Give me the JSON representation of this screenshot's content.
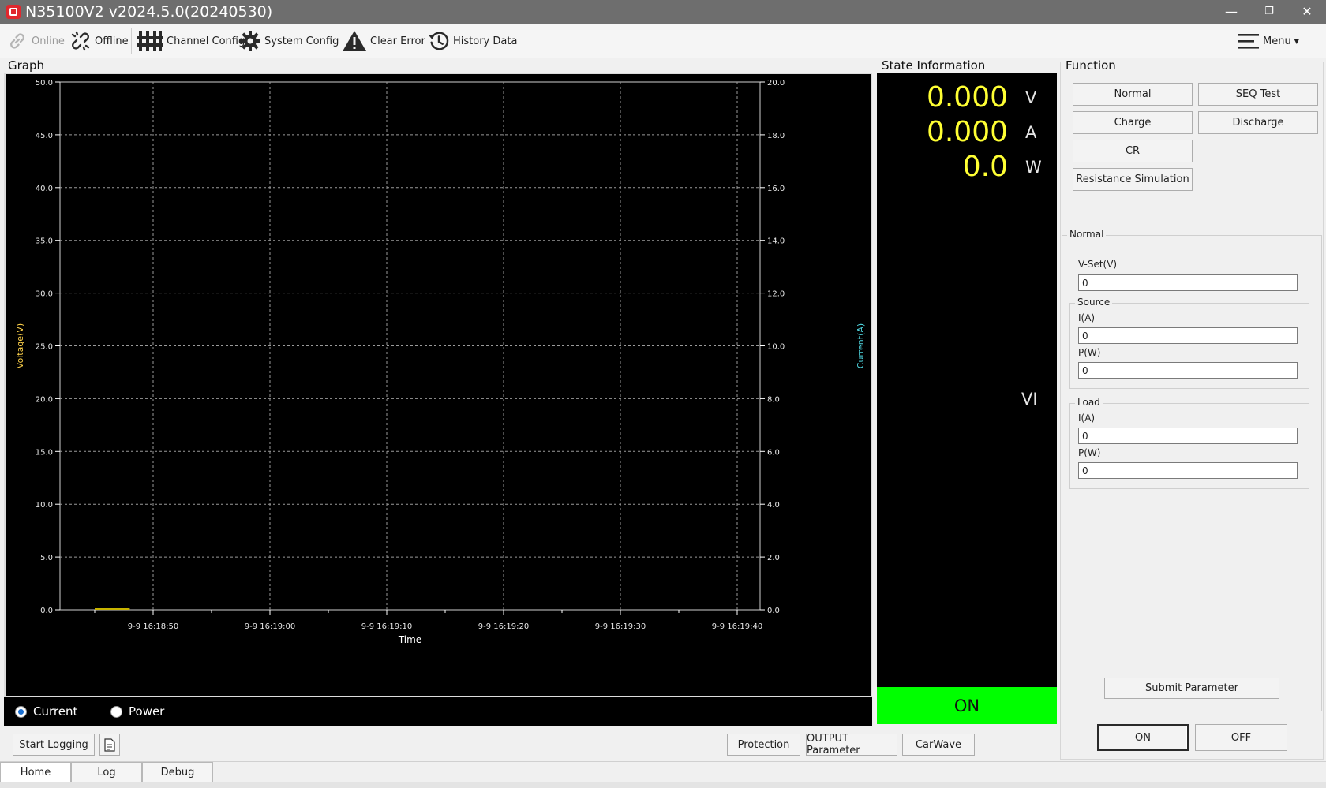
{
  "window": {
    "title": "N35100V2 v2024.5.0(20240530)",
    "controls": {
      "minimize": "—",
      "restore": "❐",
      "close": "✕"
    }
  },
  "toolbar": {
    "online": "Online",
    "offline": "Offline",
    "channel_config": "Channel Config",
    "system_config": "System Config",
    "clear_error": "Clear Error",
    "history_data": "History Data",
    "menu": "Menu"
  },
  "graph": {
    "section_title": "Graph",
    "colors": {
      "background": "#000000",
      "grid": "#9a9a9a",
      "axis": "#ffffff",
      "voltage_label": "#ffd24a",
      "current_label": "#4fd6e0",
      "trace": "#c8b400"
    }
  },
  "chart_data": {
    "type": "line",
    "xlabel": "Time",
    "ylabel": "Voltage(V)",
    "y2label": "Current(A)",
    "x_tick_labels": [
      "9-9 16:18:50",
      "9-9 16:19:00",
      "9-9 16:19:10",
      "9-9 16:19:20",
      "9-9 16:19:30",
      "9-9 16:19:40"
    ],
    "y_ticks": [
      "0.0",
      "5.0",
      "10.0",
      "15.0",
      "20.0",
      "25.0",
      "30.0",
      "35.0",
      "40.0",
      "45.0",
      "50.0"
    ],
    "y2_ticks": [
      "0.0",
      "2.0",
      "4.0",
      "6.0",
      "8.0",
      "10.0",
      "12.0",
      "14.0",
      "16.0",
      "18.0",
      "20.0"
    ],
    "ylim": [
      0,
      50
    ],
    "y2lim": [
      0,
      20
    ],
    "grid": true,
    "series": [
      {
        "axis": "left",
        "color": "#c8b400",
        "x": [
          "9-9 16:18:45",
          "9-9 16:18:48"
        ],
        "y": [
          0,
          0
        ]
      }
    ]
  },
  "graph_mode": {
    "current": "Current",
    "power": "Power",
    "selected": "current"
  },
  "state": {
    "section_title": "State Information",
    "voltage": "0.000",
    "voltage_unit": "V",
    "current": "0.000",
    "current_unit": "A",
    "power": "0.0",
    "power_unit": "W",
    "mode": "VI",
    "output_status": "ON",
    "colors": {
      "readout": "#ffff33",
      "status_on": "#00ff00"
    }
  },
  "function": {
    "section_title": "Function",
    "buttons": {
      "normal": "Normal",
      "seq_test": "SEQ Test",
      "charge": "Charge",
      "discharge": "Discharge",
      "cr": "CR",
      "resistance_simulation": "Resistance Simulation"
    },
    "normal_group": {
      "title": "Normal",
      "vset_label": "V-Set(V)",
      "vset_value": "0",
      "source": {
        "title": "Source",
        "i_label": "I(A)",
        "i_value": "0",
        "p_label": "P(W)",
        "p_value": "0"
      },
      "load": {
        "title": "Load",
        "i_label": "I(A)",
        "i_value": "0",
        "p_label": "P(W)",
        "p_value": "0"
      }
    },
    "submit": "Submit Parameter",
    "on": "ON",
    "off": "OFF"
  },
  "bottom": {
    "start_logging": "Start Logging",
    "protection": "Protection",
    "output_parameter": "OUTPUT Parameter",
    "carwave": "CarWave"
  },
  "tabs": [
    "Home",
    "Log",
    "Debug"
  ]
}
